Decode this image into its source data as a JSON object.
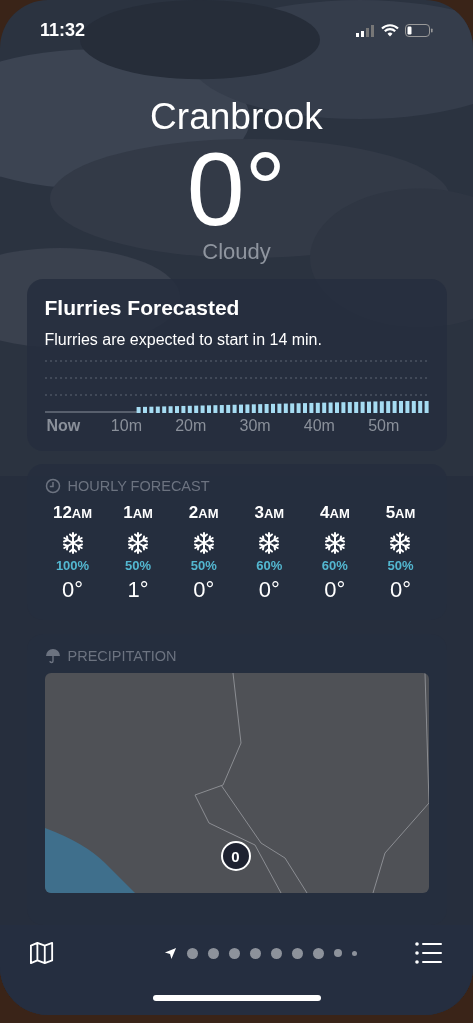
{
  "status_bar": {
    "time": "11:32"
  },
  "location": {
    "city": "Cranbrook",
    "temperature": "0°",
    "condition": "Cloudy"
  },
  "precip_card": {
    "title": "Flurries Forecasted",
    "summary": "Flurries are expected to start in 14 min.",
    "x_labels": [
      "Now",
      "10m",
      "20m",
      "30m",
      "40m",
      "50m"
    ]
  },
  "hourly": {
    "title": "HOURLY FORECAST",
    "hours": [
      {
        "time": "12",
        "period": "AM",
        "chance": "100%",
        "temp": "0°"
      },
      {
        "time": "1",
        "period": "AM",
        "chance": "50%",
        "temp": "1°"
      },
      {
        "time": "2",
        "period": "AM",
        "chance": "50%",
        "temp": "0°"
      },
      {
        "time": "3",
        "period": "AM",
        "chance": "60%",
        "temp": "0°"
      },
      {
        "time": "4",
        "period": "AM",
        "chance": "60%",
        "temp": "0°"
      },
      {
        "time": "5",
        "period": "AM",
        "chance": "50%",
        "temp": "0°"
      }
    ]
  },
  "map_card": {
    "title": "PRECIPITATION",
    "pin_label": "0"
  },
  "pages": [
    {
      "kind": "location",
      "selected": true
    },
    {
      "kind": "dot",
      "selected": false
    },
    {
      "kind": "dot",
      "selected": false
    },
    {
      "kind": "dot",
      "selected": false
    },
    {
      "kind": "dot",
      "selected": false
    },
    {
      "kind": "dot",
      "selected": false
    },
    {
      "kind": "dot",
      "selected": false
    },
    {
      "kind": "dot",
      "selected": false
    },
    {
      "kind": "small",
      "selected": false
    },
    {
      "kind": "tiny",
      "selected": false
    }
  ]
}
